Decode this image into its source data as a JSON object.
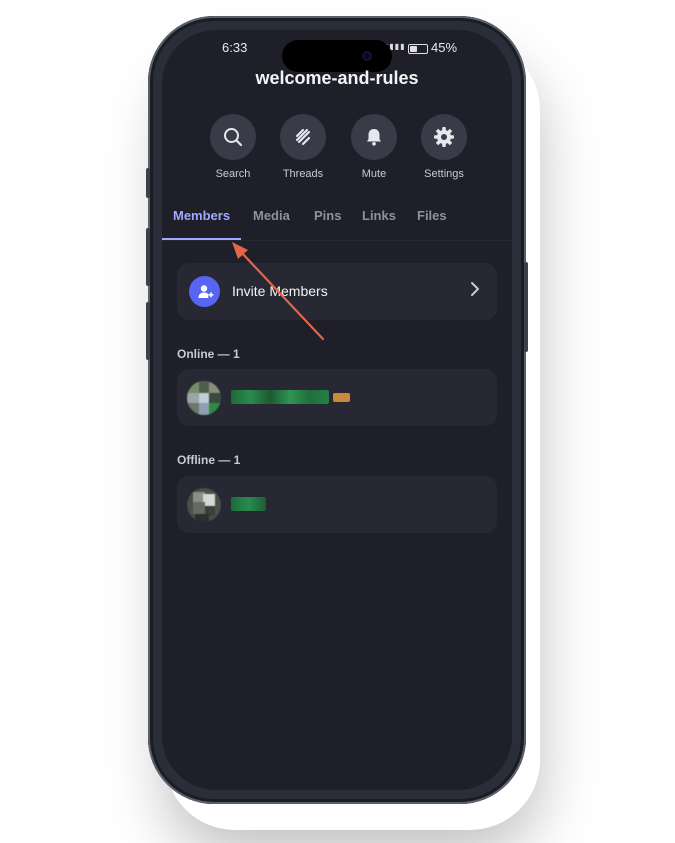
{
  "status_bar": {
    "time": "6:33",
    "battery_percent": "45%",
    "battery_level": 0.45
  },
  "header": {
    "channel_name": "welcome-and-rules"
  },
  "actions": [
    {
      "label": "Search",
      "icon": "search-icon"
    },
    {
      "label": "Threads",
      "icon": "threads-icon"
    },
    {
      "label": "Mute",
      "icon": "bell-icon"
    },
    {
      "label": "Settings",
      "icon": "gear-icon"
    }
  ],
  "tabs": [
    {
      "label": "Members",
      "active": true
    },
    {
      "label": "Media",
      "active": false
    },
    {
      "label": "Pins",
      "active": false
    },
    {
      "label": "Links",
      "active": false
    },
    {
      "label": "Files",
      "active": false
    }
  ],
  "invite": {
    "label": "Invite Members"
  },
  "sections": {
    "online": {
      "heading": "Online — 1"
    },
    "offline": {
      "heading": "Offline — 1"
    }
  },
  "colors": {
    "background": "#1e1f29",
    "card": "#272833",
    "accent": "#a3a7ff",
    "blurple": "#5865f2",
    "annotation_arrow": "#e2674a"
  }
}
